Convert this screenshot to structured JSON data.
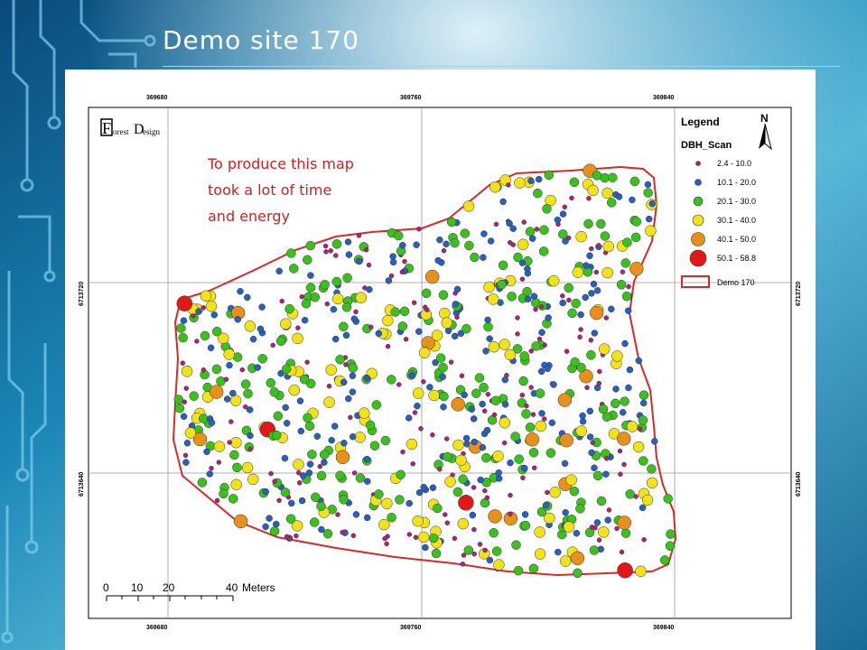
{
  "slide": {
    "title": "Demo site 170"
  },
  "map": {
    "annotation": [
      "To produce this map",
      "took a lot of time",
      "and energy"
    ],
    "logo_text": [
      "F",
      "orest",
      "D",
      "esign"
    ],
    "north_label": "N",
    "legend": {
      "title": "Legend",
      "layer": "DBH_Scan",
      "classes": [
        {
          "label": "2.4 - 10.0",
          "color": "#b0227a"
        },
        {
          "label": "10.1 - 20.0",
          "color": "#2860c0"
        },
        {
          "label": "20.1 - 30.0",
          "color": "#3cc01e"
        },
        {
          "label": "30.1 - 40.0",
          "color": "#f2e21a"
        },
        {
          "label": "40.1 - 50.0",
          "color": "#e8901c"
        },
        {
          "label": "50.1 - 58.8",
          "color": "#e01818"
        }
      ],
      "boundary_label": "Demo 170",
      "boundary_color": "#d82828"
    },
    "grid": {
      "easting_labels": [
        "369680",
        "369760",
        "369840"
      ],
      "northing_labels": [
        "6713720",
        "6713640"
      ]
    },
    "scale_bar": {
      "ticks": [
        "0",
        "10",
        "20",
        "40"
      ],
      "unit": "Meters"
    },
    "colors": {
      "slide_background": "#1a7aa8",
      "annotation_text": "#d02020",
      "grid_line": "#999999"
    }
  }
}
